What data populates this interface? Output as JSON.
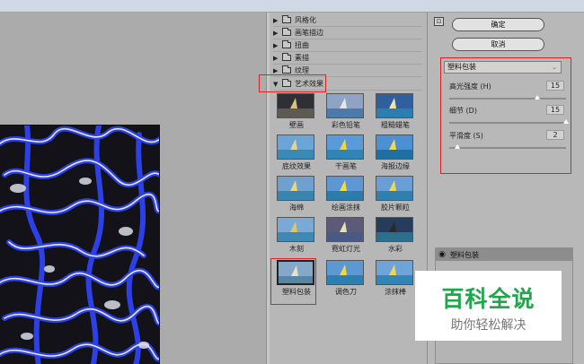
{
  "categories": [
    {
      "label": "风格化",
      "expanded": false
    },
    {
      "label": "画笔描边",
      "expanded": false
    },
    {
      "label": "扭曲",
      "expanded": false
    },
    {
      "label": "素描",
      "expanded": false
    },
    {
      "label": "纹理",
      "expanded": false
    },
    {
      "label": "艺术效果",
      "expanded": true
    }
  ],
  "filters": [
    {
      "label": "壁画"
    },
    {
      "label": "彩色铅笔"
    },
    {
      "label": "粗糙蜡笔"
    },
    {
      "label": "底纹效果"
    },
    {
      "label": "干画笔"
    },
    {
      "label": "海报边缘"
    },
    {
      "label": "海绵"
    },
    {
      "label": "绘画涂抹"
    },
    {
      "label": "胶片颗粒"
    },
    {
      "label": "木刻"
    },
    {
      "label": "霓虹灯光"
    },
    {
      "label": "水彩"
    },
    {
      "label": "塑料包装",
      "selected": true
    },
    {
      "label": "调色刀"
    },
    {
      "label": "涂抹棒"
    }
  ],
  "buttons": {
    "ok": "确定",
    "cancel": "取消"
  },
  "selected_filter": "塑料包装",
  "params": [
    {
      "label": "高光强度 (H)",
      "value": "15",
      "fraction": 0.75
    },
    {
      "label": "细节 (D)",
      "value": "15",
      "fraction": 1.0
    },
    {
      "label": "平滑度 (S)",
      "value": "2",
      "fraction": 0.07
    }
  ],
  "layer_label": "塑料包装",
  "watermark": {
    "title": "百科全说",
    "subtitle": "助你轻松解决"
  },
  "colors": {
    "highlight_box": "#e3202a",
    "watermark_green": "#20a64b",
    "preview_blue": "#2a3fe0"
  }
}
